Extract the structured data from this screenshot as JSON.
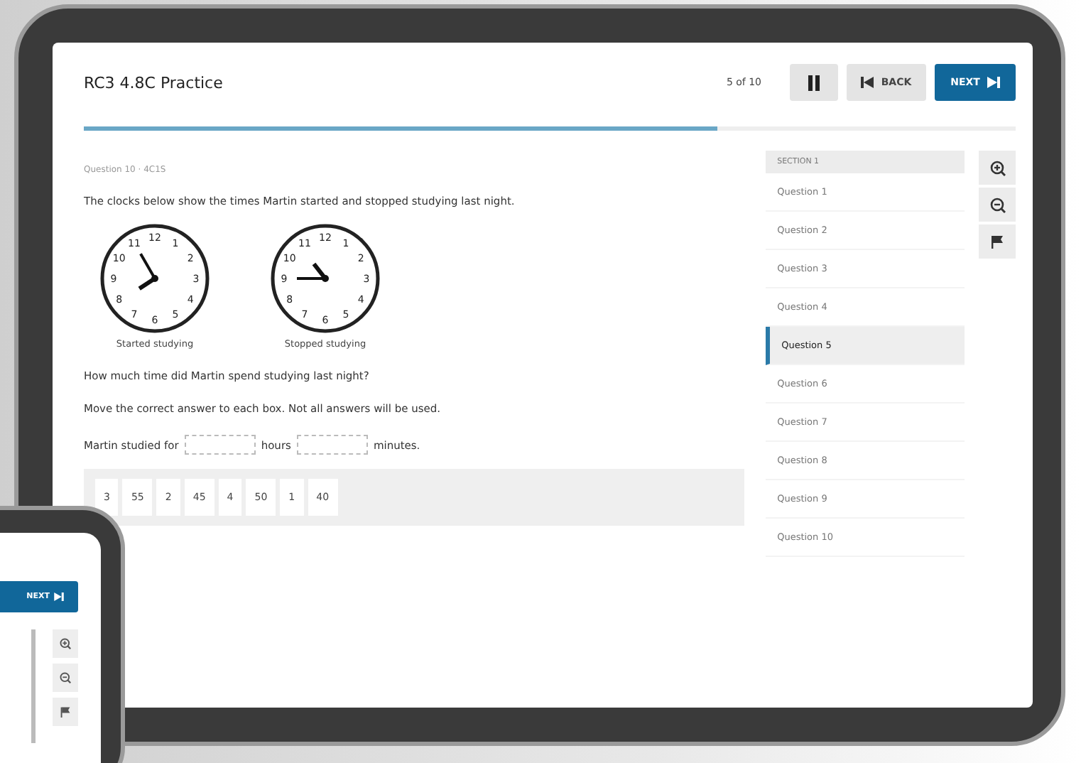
{
  "header": {
    "title": "RC3 4.8C Practice",
    "position": "5 of 10",
    "back": "BACK",
    "next": "NEXT",
    "progress": {
      "level": 0.68
    }
  },
  "question": {
    "label": "Question 10 · 4C1S",
    "prompt": "The clocks below show the times Martin started and stopped studying last night.",
    "clocks": [
      {
        "caption": "Started studying",
        "numbers": [
          "11",
          "12",
          "1",
          "10",
          "2",
          "9",
          "3",
          "8",
          "4",
          "7",
          "6",
          "5"
        ]
      },
      {
        "caption": "Stopped studying",
        "numbers": [
          "11",
          "12",
          "1",
          "10",
          "2",
          "9",
          "3",
          "8",
          "4",
          "7",
          "6",
          "5"
        ]
      }
    ],
    "ask": "How much time did Martin spend studying last night?",
    "instruction": "Move the correct answer to each box. Not all answers will be used.",
    "sentence": [
      {
        "kind": "text",
        "text": "Martin studied for"
      },
      {
        "kind": "box"
      },
      {
        "kind": "text",
        "text": "hours"
      },
      {
        "kind": "box"
      },
      {
        "kind": "text",
        "text": "minutes."
      }
    ],
    "answers": [
      "3",
      "55",
      "2",
      "45",
      "4",
      "50",
      "1",
      "40"
    ]
  },
  "sidebar": {
    "section": "SECTION 1",
    "items": [
      {
        "label": "Question 1",
        "selected": false
      },
      {
        "label": "Question 2",
        "selected": false
      },
      {
        "label": "Question 3",
        "selected": false
      },
      {
        "label": "Question 4",
        "selected": false
      },
      {
        "label": "Question 5",
        "selected": true
      },
      {
        "label": "Question 6",
        "selected": false
      },
      {
        "label": "Question 7",
        "selected": false
      },
      {
        "label": "Question 8",
        "selected": false
      },
      {
        "label": "Question 9",
        "selected": false
      },
      {
        "label": "Question 10",
        "selected": false
      }
    ]
  },
  "tools": [
    {
      "kind": "zoom-in"
    },
    {
      "kind": "zoom-out"
    },
    {
      "kind": "flag"
    }
  ],
  "phone": {
    "next": "NEXT",
    "tools": [
      {
        "kind": "zoom-in"
      },
      {
        "kind": "zoom-out"
      },
      {
        "kind": "flag"
      }
    ]
  }
}
